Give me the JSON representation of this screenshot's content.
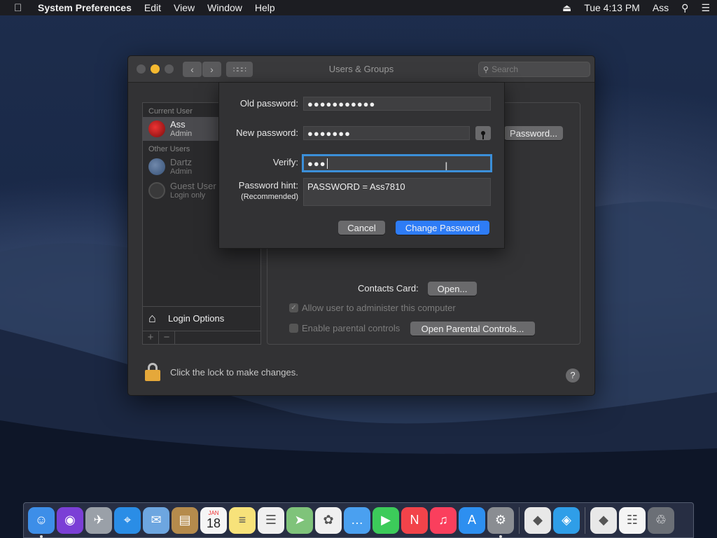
{
  "menubar": {
    "app_name": "System Preferences",
    "menus": [
      "Edit",
      "View",
      "Window",
      "Help"
    ],
    "clock": "Tue 4:13 PM",
    "user": "Ass"
  },
  "window": {
    "title": "Users & Groups",
    "search_placeholder": "Search"
  },
  "sidebar": {
    "current_user_label": "Current User",
    "current_user": {
      "name": "Ass",
      "role": "Admin"
    },
    "other_users_label": "Other Users",
    "other_users": [
      {
        "name": "Dartz",
        "role": "Admin"
      },
      {
        "name": "Guest User",
        "role": "Login only"
      }
    ],
    "login_options": "Login Options",
    "add": "+",
    "remove": "−"
  },
  "pane": {
    "change_password_btn": "Password...",
    "contacts_label": "Contacts Card:",
    "open_btn": "Open...",
    "allow_admin": "Allow user to administer this computer",
    "parental": "Enable parental controls",
    "open_parental_btn": "Open Parental Controls..."
  },
  "lock_text": "Click the lock to make changes.",
  "help": "?",
  "sheet": {
    "old_label": "Old password:",
    "old_value": "●●●●●●●●●●●",
    "new_label": "New password:",
    "new_value": "●●●●●●●",
    "verify_label": "Verify:",
    "verify_value": "●●●",
    "hint_label": "Password hint:",
    "hint_sub": "(Recommended)",
    "hint_value": "PASSWORD = Ass7810",
    "cancel": "Cancel",
    "change": "Change Password"
  },
  "colors": {
    "accent": "#2e7cf6",
    "focus_ring": "#3b8fd9",
    "window_bg": "#323234"
  },
  "dock": [
    {
      "name": "finder-icon",
      "color": "#3d8ee8",
      "running": true
    },
    {
      "name": "siri-icon",
      "color": "#7b3fd6"
    },
    {
      "name": "launchpad-icon",
      "color": "#9aa0a8"
    },
    {
      "name": "safari-icon",
      "color": "#2a8de6"
    },
    {
      "name": "mail-icon",
      "color": "#6da6e0"
    },
    {
      "name": "contacts-icon",
      "color": "#b58b4c"
    },
    {
      "name": "calendar-icon",
      "color": "#f5f5f5"
    },
    {
      "name": "notes-icon",
      "color": "#f7e27a"
    },
    {
      "name": "reminders-icon",
      "color": "#f0f0f0"
    },
    {
      "name": "maps-icon",
      "color": "#7fc37a"
    },
    {
      "name": "photos-icon",
      "color": "#f0f0f0"
    },
    {
      "name": "messages-icon",
      "color": "#4aa0f0"
    },
    {
      "name": "facetime-icon",
      "color": "#3ccb5a"
    },
    {
      "name": "news-icon",
      "color": "#f2434a"
    },
    {
      "name": "music-icon",
      "color": "#fa3f5d"
    },
    {
      "name": "app-store-icon",
      "color": "#2d8ff0"
    },
    {
      "name": "system-preferences-icon",
      "color": "#8a8d92",
      "running": true
    },
    {
      "name": "roblox-icon",
      "color": "#e8e8e8"
    },
    {
      "name": "roblox-studio-icon",
      "color": "#2f9ee8"
    },
    {
      "name": "roblox-player-icon",
      "color": "#e8e8e8"
    },
    {
      "name": "document-icon",
      "color": "#f5f5f5"
    },
    {
      "name": "trash-icon",
      "color": "#6b6f76"
    }
  ],
  "calendar_icon": {
    "month": "JAN",
    "day": "18"
  }
}
